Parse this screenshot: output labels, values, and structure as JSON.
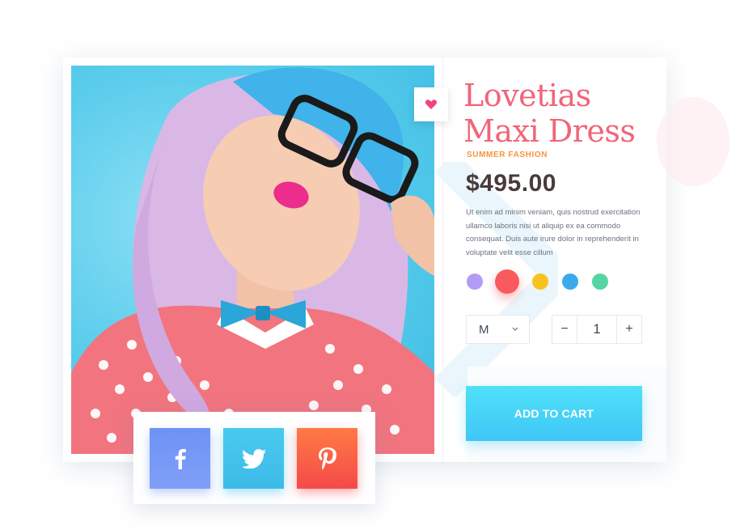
{
  "product": {
    "title": "Lovetias Maxi Dress",
    "category": "SUMMER FASHION",
    "price": "$495.00",
    "description": "Ut enim ad minim veniam, quis nostrud exercitation ullamco laboris nisi ut aliquip ex ea commodo consequat. Duis aute irure dolor in reprehenderit in voluptate velit esse cillum"
  },
  "colors": [
    "#b39cf5",
    "#f85a5f",
    "#f7c41f",
    "#3ba9ec",
    "#55d5a1"
  ],
  "selected_color_index": 1,
  "size": {
    "value": "M"
  },
  "quantity": {
    "minus": "−",
    "value": "1",
    "plus": "+"
  },
  "cart": {
    "label": "ADD TO CART"
  },
  "share": {
    "facebook_icon": "facebook-icon",
    "twitter_icon": "twitter-icon",
    "pinterest_icon": "pinterest-icon"
  },
  "icons": {
    "wishlist": "heart-icon",
    "dropdown": "chevron-down-icon"
  }
}
